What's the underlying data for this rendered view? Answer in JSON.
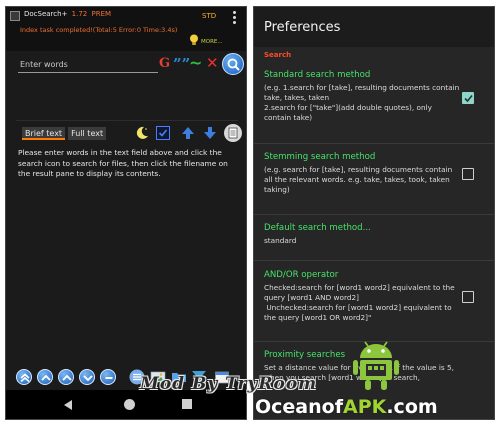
{
  "left_app": {
    "title": "DocSearch+",
    "version": "1.72",
    "edition": "PREM",
    "mode_label": "STD",
    "index_status": "Index task completed!(Total:5 Error:0 Time:3.4s)",
    "more_label": "MORE...",
    "search": {
      "placeholder": "Enter words",
      "buttons": {
        "g": "G",
        "quote": "””",
        "tilde": "~",
        "clear": "✕"
      }
    },
    "tabs": {
      "brief": "Brief text",
      "full": "Full text"
    },
    "help_text": "Please enter words in the text field above and click the search icon to search for files, then click the filename on the result pane to display its contents."
  },
  "preferences": {
    "title": "Preferences",
    "section": "Search",
    "items": [
      {
        "title": "Standard search method",
        "summary": "(e.g. 1.search for [take], resulting documents contain take, takes, taken\n2.search for [\"take\"](add double quotes), only contain take)",
        "checked": true
      },
      {
        "title": "Stemming search method",
        "summary": "(e.g. search for [take], resulting documents contain all the relevant words. e.g. take, takes, took, taken taking)",
        "checked": false
      },
      {
        "title": "Default search method...",
        "summary": "standard"
      },
      {
        "title": "AND/OR operator",
        "summary": "Checked:search for [word1 word2] equivalent to the query [word1 AND word2]\n Unchecked:search for [word1 word2] equivalent to the query [word1 OR word2]\"",
        "checked": false
      },
      {
        "title": "Proximity searches",
        "summary": "Set a distance value for words, e.g. if the value is 5, when you search [word1 word2] to search,"
      }
    ]
  },
  "watermarks": {
    "mod_by": "Mod By TryRoom",
    "site_prefix": "Ocean",
    "site_of": "of",
    "site_apk": "APK",
    "site_suffix": ".com"
  },
  "colors": {
    "accent_green": "#46e46a",
    "accent_red": "#ff4b25",
    "accent_orange": "#f07030",
    "check_teal": "#8fd5c8"
  }
}
